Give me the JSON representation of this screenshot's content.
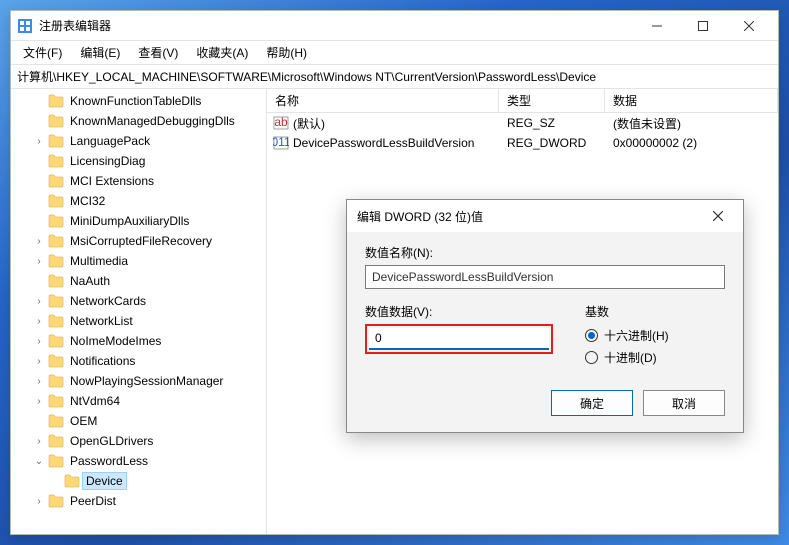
{
  "window": {
    "title": "注册表编辑器"
  },
  "menus": {
    "file": "文件(F)",
    "edit": "编辑(E)",
    "view": "查看(V)",
    "favorites": "收藏夹(A)",
    "help": "帮助(H)"
  },
  "address": "计算机\\HKEY_LOCAL_MACHINE\\SOFTWARE\\Microsoft\\Windows NT\\CurrentVersion\\PasswordLess\\Device",
  "tree": [
    {
      "label": "KnownFunctionTableDlls",
      "indent": 1,
      "expand": ""
    },
    {
      "label": "KnownManagedDebuggingDlls",
      "indent": 1,
      "expand": ""
    },
    {
      "label": "LanguagePack",
      "indent": 1,
      "expand": ">"
    },
    {
      "label": "LicensingDiag",
      "indent": 1,
      "expand": ""
    },
    {
      "label": "MCI Extensions",
      "indent": 1,
      "expand": ""
    },
    {
      "label": "MCI32",
      "indent": 1,
      "expand": ""
    },
    {
      "label": "MiniDumpAuxiliaryDlls",
      "indent": 1,
      "expand": ""
    },
    {
      "label": "MsiCorruptedFileRecovery",
      "indent": 1,
      "expand": ">"
    },
    {
      "label": "Multimedia",
      "indent": 1,
      "expand": ">"
    },
    {
      "label": "NaAuth",
      "indent": 1,
      "expand": ""
    },
    {
      "label": "NetworkCards",
      "indent": 1,
      "expand": ">"
    },
    {
      "label": "NetworkList",
      "indent": 1,
      "expand": ">"
    },
    {
      "label": "NoImeModeImes",
      "indent": 1,
      "expand": ">"
    },
    {
      "label": "Notifications",
      "indent": 1,
      "expand": ">"
    },
    {
      "label": "NowPlayingSessionManager",
      "indent": 1,
      "expand": ">"
    },
    {
      "label": "NtVdm64",
      "indent": 1,
      "expand": ">"
    },
    {
      "label": "OEM",
      "indent": 1,
      "expand": ""
    },
    {
      "label": "OpenGLDrivers",
      "indent": 1,
      "expand": ">"
    },
    {
      "label": "PasswordLess",
      "indent": 1,
      "expand": "v"
    },
    {
      "label": "Device",
      "indent": 2,
      "expand": "",
      "selected": true
    },
    {
      "label": "PeerDist",
      "indent": 1,
      "expand": ">"
    }
  ],
  "columns": {
    "name": "名称",
    "type": "类型",
    "data": "数据"
  },
  "rows": [
    {
      "icon": "string",
      "name": "(默认)",
      "type": "REG_SZ",
      "data": "(数值未设置)"
    },
    {
      "icon": "binary",
      "name": "DevicePasswordLessBuildVersion",
      "type": "REG_DWORD",
      "data": "0x00000002 (2)"
    }
  ],
  "dialog": {
    "title": "编辑 DWORD (32 位)值",
    "name_label": "数值名称(N):",
    "name_value": "DevicePasswordLessBuildVersion",
    "data_label": "数值数据(V):",
    "data_value": "0",
    "base_label": "基数",
    "radio_hex": "十六进制(H)",
    "radio_dec": "十进制(D)",
    "ok": "确定",
    "cancel": "取消"
  }
}
